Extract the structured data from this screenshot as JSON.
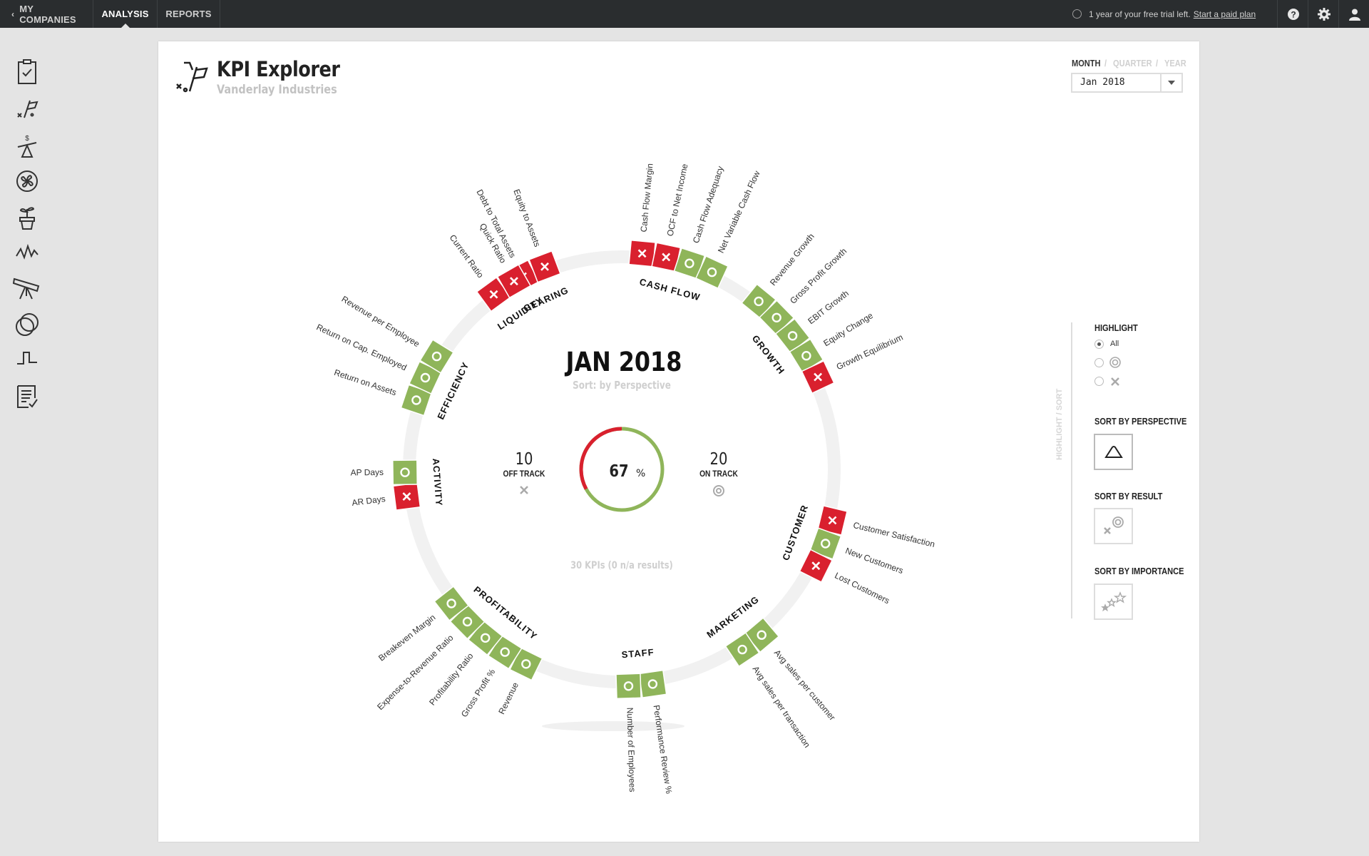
{
  "topbar": {
    "nav": [
      {
        "label": "MY COMPANIES"
      },
      {
        "label": "ANALYSIS",
        "active": true
      },
      {
        "label": "REPORTS"
      }
    ],
    "trial_text": "1 year of your free trial left.",
    "trial_link": "Start a paid plan",
    "icons": [
      "help-icon",
      "settings-icon",
      "user-icon"
    ]
  },
  "sidebar": {
    "icons": [
      "clipboard-check-icon",
      "kpi-flag-icon",
      "balance-scale-icon",
      "fan-icon",
      "plant-pot-icon",
      "pulse-icon",
      "telescope-icon",
      "overlap-circles-icon",
      "step-chart-icon",
      "report-check-icon"
    ]
  },
  "header": {
    "title": "KPI Explorer",
    "subtitle": "Vanderlay Industries",
    "periods": [
      "MONTH",
      "QUARTER",
      "YEAR"
    ],
    "selected_period": "MONTH",
    "separator": "/",
    "date_value": "Jan 2018"
  },
  "center": {
    "period": "JAN 2018",
    "sort_label": "Sort: by Perspective",
    "off_track_count": "10",
    "off_track_label": "OFF TRACK",
    "on_track_count": "20",
    "on_track_label": "ON TRACK",
    "percent": "67",
    "percent_sign": "%",
    "percent_value": 0.67,
    "total_label": "30 KPIs (0 n/a results)"
  },
  "right_panel": {
    "vertical_label": "HIGHLIGHT / SORT",
    "highlight_title": "HIGHLIGHT",
    "highlight_all": "All",
    "highlight_selected": "All",
    "sort_perspective": "SORT BY PERSPECTIVE",
    "sort_result": "SORT BY RESULT",
    "sort_importance": "SORT BY IMPORTANCE",
    "sort_selected": "SORT BY PERSPECTIVE"
  },
  "colors": {
    "on_track": "#8fb55a",
    "off_track": "#d9202e",
    "ring": "#f1f1f1",
    "topbar": "#2a2d2f"
  },
  "perspectives": [
    {
      "name": "GEARING",
      "kpis": [
        {
          "label": "Debt to Total Assets",
          "status": "off"
        },
        {
          "label": "Equity to Assets",
          "status": "off"
        }
      ]
    },
    {
      "name": "CASH FLOW",
      "kpis": [
        {
          "label": "Cash Flow Margin",
          "status": "off"
        },
        {
          "label": "OCF to Net Income",
          "status": "off"
        },
        {
          "label": "Cash Flow Adequacy",
          "status": "on"
        },
        {
          "label": "Net Variable Cash Flow",
          "status": "on"
        }
      ]
    },
    {
      "name": "GROWTH",
      "kpis": [
        {
          "label": "Revenue Growth",
          "status": "on"
        },
        {
          "label": "Gross Profit Growth",
          "status": "on"
        },
        {
          "label": "EBIT Growth",
          "status": "on"
        },
        {
          "label": "Equity Change",
          "status": "on"
        },
        {
          "label": "Growth Equilibrium",
          "status": "off"
        }
      ]
    },
    {
      "name": "CUSTOMER",
      "kpis": [
        {
          "label": "Customer Satisfaction",
          "status": "off"
        },
        {
          "label": "New Customers",
          "status": "on"
        },
        {
          "label": "Lost Customers",
          "status": "off"
        }
      ]
    },
    {
      "name": "MARKETING",
      "kpis": [
        {
          "label": "Avg sales per customer",
          "status": "on"
        },
        {
          "label": "Avg sales per transaction",
          "status": "on"
        }
      ]
    },
    {
      "name": "STAFF",
      "kpis": [
        {
          "label": "Performance Review %",
          "status": "on"
        },
        {
          "label": "Number of Employees",
          "status": "on"
        }
      ]
    },
    {
      "name": "PROFITABILITY",
      "kpis": [
        {
          "label": "Revenue",
          "status": "on"
        },
        {
          "label": "Gross Profit %",
          "status": "on"
        },
        {
          "label": "Profitability Ratio",
          "status": "on"
        },
        {
          "label": "Expense-to-Revenue Ratio",
          "status": "on"
        },
        {
          "label": "Breakeven Margin",
          "status": "on"
        }
      ]
    },
    {
      "name": "ACTIVITY",
      "kpis": [
        {
          "label": "AR Days",
          "status": "off"
        },
        {
          "label": "AP Days",
          "status": "on"
        }
      ]
    },
    {
      "name": "EFFICIENCY",
      "kpis": [
        {
          "label": "Return on Assets",
          "status": "on"
        },
        {
          "label": "Return on Cap. Employed",
          "status": "on"
        },
        {
          "label": "Revenue per Employee",
          "status": "on"
        }
      ]
    },
    {
      "name": "LIQUIDITY",
      "kpis": [
        {
          "label": "Current Ratio",
          "status": "off"
        },
        {
          "label": "Quick Ratio",
          "status": "off"
        }
      ]
    }
  ]
}
